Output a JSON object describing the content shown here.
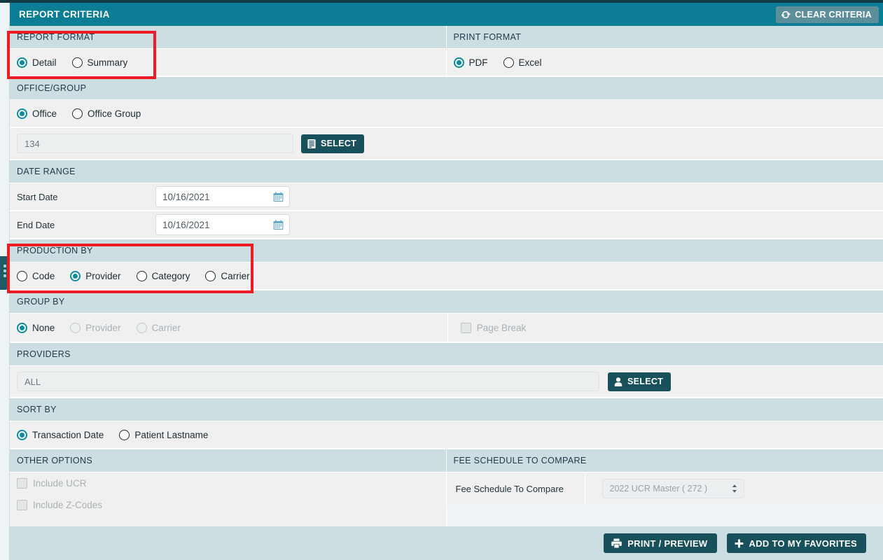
{
  "header": {
    "title": "REPORT CRITERIA",
    "clear_button": "CLEAR CRITERIA",
    "clear_icon": "refresh-icon"
  },
  "report_format": {
    "legend": "REPORT FORMAT",
    "options": [
      {
        "label": "Detail",
        "selected": true
      },
      {
        "label": "Summary",
        "selected": false
      }
    ]
  },
  "print_format": {
    "legend": "PRINT FORMAT",
    "options": [
      {
        "label": "PDF",
        "selected": true
      },
      {
        "label": "Excel",
        "selected": false
      }
    ]
  },
  "office_group": {
    "legend": "OFFICE/GROUP",
    "options": [
      {
        "label": "Office",
        "selected": true
      },
      {
        "label": "Office Group",
        "selected": false
      }
    ],
    "office_value": "134",
    "select_button": "SELECT",
    "select_icon": "building-icon"
  },
  "date_range": {
    "legend": "DATE RANGE",
    "start_label": "Start Date",
    "start_value": "10/16/2021",
    "end_label": "End Date",
    "end_value": "10/16/2021",
    "calendar_icon": "calendar-icon"
  },
  "production_by": {
    "legend": "PRODUCTION BY",
    "options": [
      {
        "label": "Code",
        "selected": false
      },
      {
        "label": "Provider",
        "selected": true
      },
      {
        "label": "Category",
        "selected": false
      },
      {
        "label": "Carrier",
        "selected": false
      }
    ]
  },
  "group_by": {
    "legend": "GROUP BY",
    "options": [
      {
        "label": "None",
        "selected": true,
        "disabled": false
      },
      {
        "label": "Provider",
        "selected": false,
        "disabled": true
      },
      {
        "label": "Carrier",
        "selected": false,
        "disabled": true
      }
    ],
    "page_break_label": "Page Break",
    "page_break_checked": false
  },
  "providers": {
    "legend": "PROVIDERS",
    "value": "ALL",
    "select_button": "SELECT",
    "select_icon": "user-icon"
  },
  "sort_by": {
    "legend": "SORT BY",
    "options": [
      {
        "label": "Transaction Date",
        "selected": true
      },
      {
        "label": "Patient Lastname",
        "selected": false
      }
    ]
  },
  "other_options": {
    "legend": "OTHER OPTIONS",
    "checkboxes": [
      {
        "label": "Include UCR",
        "checked": false,
        "disabled": true
      },
      {
        "label": "Include Z-Codes",
        "checked": false,
        "disabled": true
      }
    ]
  },
  "fee_schedule": {
    "legend": "FEE SCHEDULE TO COMPARE",
    "field_label": "Fee Schedule To Compare",
    "selected_option": "2022 UCR Master ( 272 )",
    "stepper_icon": "updown-arrows-icon"
  },
  "footer": {
    "print_preview": "PRINT / PREVIEW",
    "print_icon": "printer-icon",
    "add_favorites": "ADD TO MY FAVORITES",
    "plus_icon": "plus-icon"
  },
  "annotations": {
    "highlight_color": "#ef1b24",
    "boxes": [
      "report-format-highlight",
      "production-by-highlight"
    ]
  },
  "theme": {
    "header_teal": "#0b7d95",
    "section_header": "#cddee2",
    "row_bg": "#f0f0f0",
    "button_dark": "#18515c",
    "radio_accent": "#0b8ca3"
  }
}
